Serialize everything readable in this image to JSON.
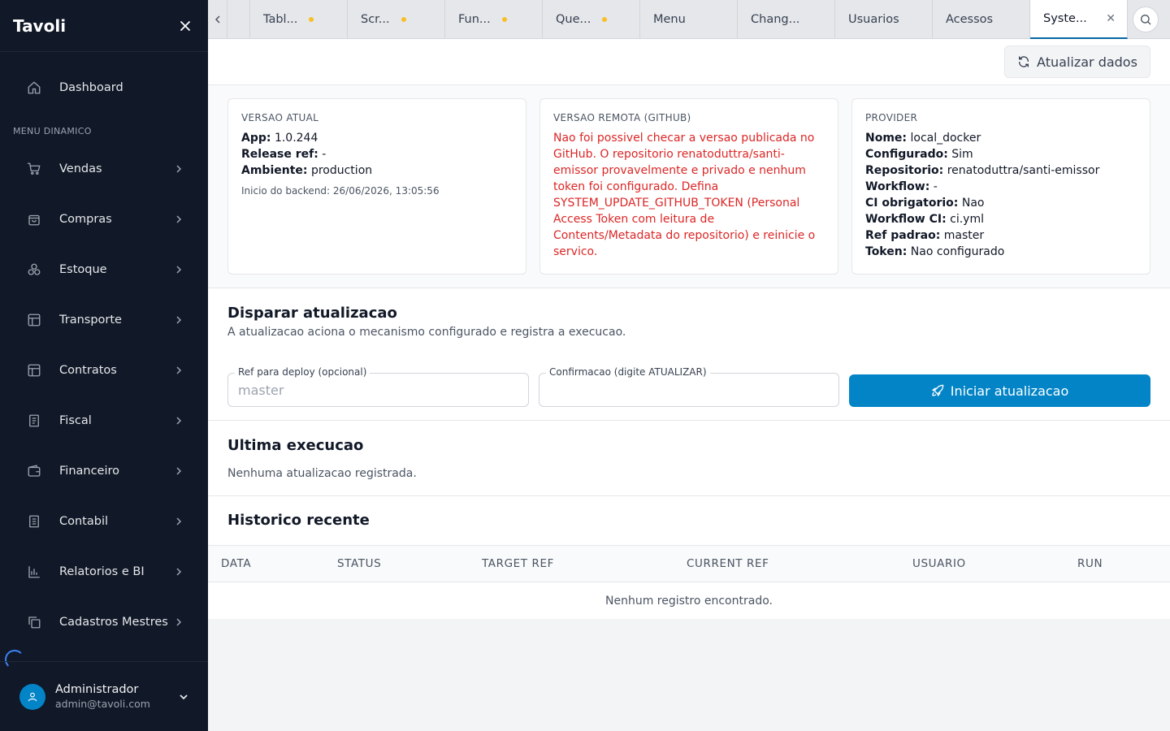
{
  "sidebar": {
    "title": "Tavoli",
    "dashboard": "Dashboard",
    "section_label": "MENU DINAMICO",
    "items": [
      {
        "label": "Vendas",
        "icon": "cart-icon"
      },
      {
        "label": "Compras",
        "icon": "bag-icon"
      },
      {
        "label": "Estoque",
        "icon": "boxes-icon"
      },
      {
        "label": "Transporte",
        "icon": "layout-icon"
      },
      {
        "label": "Contratos",
        "icon": "layout-icon"
      },
      {
        "label": "Fiscal",
        "icon": "document-icon"
      },
      {
        "label": "Financeiro",
        "icon": "wallet-icon"
      },
      {
        "label": "Contabil",
        "icon": "ledger-icon"
      },
      {
        "label": "Relatorios e BI",
        "icon": "chart-icon"
      },
      {
        "label": "Cadastros Mestres",
        "icon": "copy-icon"
      }
    ],
    "user": {
      "name": "Administrador",
      "email": "admin@tavoli.com"
    }
  },
  "tabs": [
    {
      "label": "Tabl...",
      "dirty": true
    },
    {
      "label": "Scr...",
      "dirty": true
    },
    {
      "label": "Fun...",
      "dirty": true
    },
    {
      "label": "Que...",
      "dirty": true
    },
    {
      "label": "Menu",
      "dirty": false
    },
    {
      "label": "Chang...",
      "dirty": false
    },
    {
      "label": "Usuarios",
      "dirty": false
    },
    {
      "label": "Acessos",
      "dirty": false
    },
    {
      "label": "Syste...",
      "dirty": false,
      "active": true
    }
  ],
  "toolbar": {
    "refresh_label": "Atualizar dados"
  },
  "cards": {
    "current": {
      "title": "VERSAO ATUAL",
      "app_key": "App:",
      "app_val": "1.0.244",
      "release_key": "Release ref:",
      "release_val": "-",
      "env_key": "Ambiente:",
      "env_val": "production",
      "backend_start": "Inicio do backend: 26/06/2026, 13:05:56"
    },
    "remote": {
      "title": "VERSAO REMOTA (GITHUB)",
      "error": "Nao foi possivel checar a versao publicada no GitHub. O repositorio renatoduttra/santi-emissor provavelmente e privado e nenhum token foi configurado. Defina SYSTEM_UPDATE_GITHUB_TOKEN (Personal Access Token com leitura de Contents/Metadata do repositorio) e reinicie o servico."
    },
    "provider": {
      "title": "PROVIDER",
      "rows": [
        {
          "k": "Nome:",
          "v": "local_docker"
        },
        {
          "k": "Configurado:",
          "v": "Sim"
        },
        {
          "k": "Repositorio:",
          "v": "renatoduttra/santi-emissor"
        },
        {
          "k": "Workflow:",
          "v": "-"
        },
        {
          "k": "CI obrigatorio:",
          "v": "Nao"
        },
        {
          "k": "Workflow CI:",
          "v": "ci.yml"
        },
        {
          "k": "Ref padrao:",
          "v": "master"
        },
        {
          "k": "Token:",
          "v": "Nao configurado"
        }
      ]
    }
  },
  "deploy": {
    "title": "Disparar atualizacao",
    "subtitle": "A atualizacao aciona o mecanismo configurado e registra a execucao.",
    "ref_label": "Ref para deploy (opcional)",
    "ref_placeholder": "master",
    "ref_value": "",
    "confirm_label": "Confirmacao (digite ATUALIZAR)",
    "confirm_value": "",
    "start_label": "Iniciar atualizacao"
  },
  "last_exec": {
    "title": "Ultima execucao",
    "text": "Nenhuma atualizacao registrada."
  },
  "history": {
    "title": "Historico recente",
    "columns": [
      "DATA",
      "STATUS",
      "TARGET REF",
      "CURRENT REF",
      "USUARIO",
      "RUN"
    ],
    "empty": "Nenhum registro encontrado."
  },
  "colors": {
    "sidebar_bg": "#111827",
    "accent": "#0284c7",
    "error": "#dc2626",
    "dirty_dot": "#fbbf24"
  }
}
